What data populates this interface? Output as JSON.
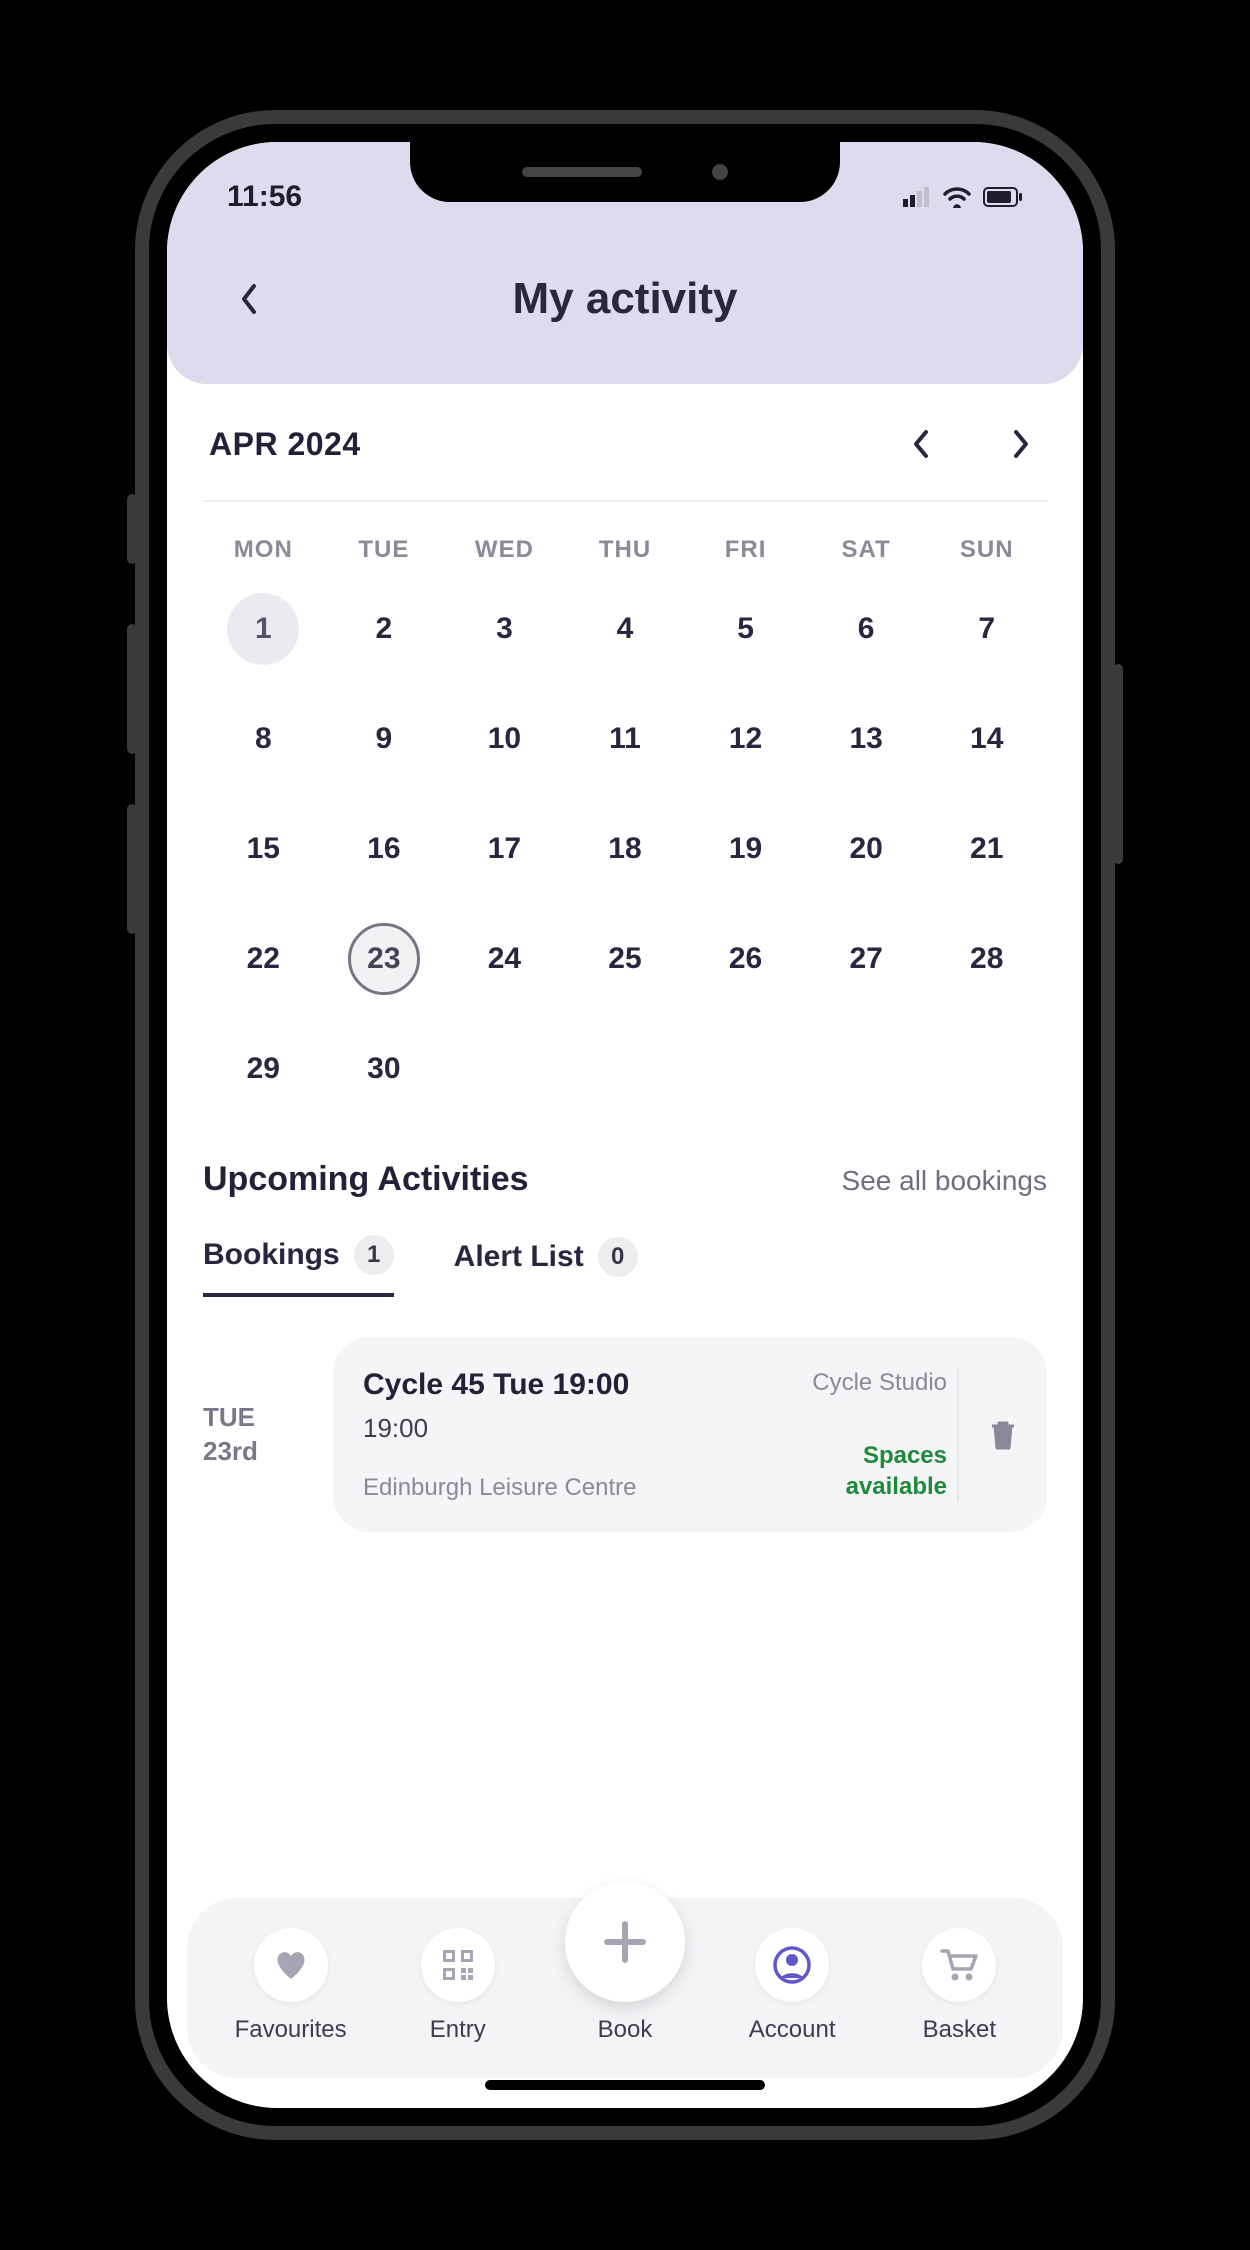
{
  "status": {
    "time": "11:56"
  },
  "header": {
    "title": "My activity"
  },
  "calendar": {
    "month_label": "APR 2024",
    "weekdays": [
      "MON",
      "TUE",
      "WED",
      "THU",
      "FRI",
      "SAT",
      "SUN"
    ],
    "days": [
      1,
      2,
      3,
      4,
      5,
      6,
      7,
      8,
      9,
      10,
      11,
      12,
      13,
      14,
      15,
      16,
      17,
      18,
      19,
      20,
      21,
      22,
      23,
      24,
      25,
      26,
      27,
      28,
      29,
      30
    ],
    "past_day": 1,
    "selected_day": 23
  },
  "upcoming": {
    "title": "Upcoming Activities",
    "see_all": "See all bookings",
    "tabs": {
      "bookings_label": "Bookings",
      "bookings_count": "1",
      "alert_label": "Alert List",
      "alert_count": "0"
    },
    "booking": {
      "day_label": "TUE",
      "date_label": "23rd",
      "title": "Cycle 45 Tue 19:00",
      "time": "19:00",
      "venue": "Edinburgh Leisure Centre",
      "room": "Cycle Studio",
      "status": "Spaces available"
    }
  },
  "nav": {
    "favourites": "Favourites",
    "entry": "Entry",
    "book": "Book",
    "account": "Account",
    "basket": "Basket"
  },
  "colors": {
    "accent": "#6058c8",
    "success": "#1f8a3b"
  }
}
